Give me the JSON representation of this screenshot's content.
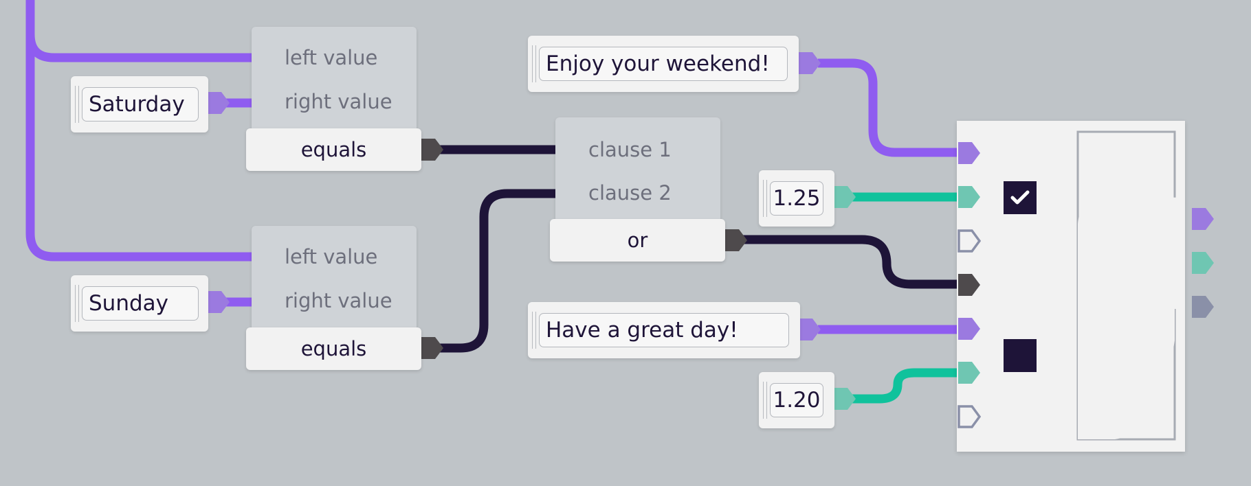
{
  "equals_top": {
    "left_label": "left value",
    "right_label": "right value",
    "op_label": "equals",
    "right_input": "Saturday"
  },
  "equals_bottom": {
    "left_label": "left value",
    "right_label": "right value",
    "op_label": "equals",
    "right_input": "Sunday"
  },
  "or_node": {
    "clause1_label": "clause 1",
    "clause2_label": "clause 2",
    "op_label": "or"
  },
  "text_inputs": {
    "weekend_message": "Enjoy your weekend!",
    "weekday_message": "Have a great day!"
  },
  "number_inputs": {
    "value_a": "1.25",
    "value_b": "1.20"
  },
  "output_node": {
    "checkbox_1_checked": true,
    "checkbox_2_checked": false
  },
  "colors": {
    "canvas": "#bfc4c8",
    "string_wire": "#8f5cf0",
    "string_port": "#9b7ae0",
    "number_wire": "#10c29c",
    "number_port": "#6fc6b2",
    "boolean_wire": "#1e1438",
    "boolean_port": "#4e4a4c",
    "empty_port": "#8a90a8",
    "node_body": "#cfd3d7",
    "node_button": "#f2f2f2",
    "text": "#1e1438"
  }
}
